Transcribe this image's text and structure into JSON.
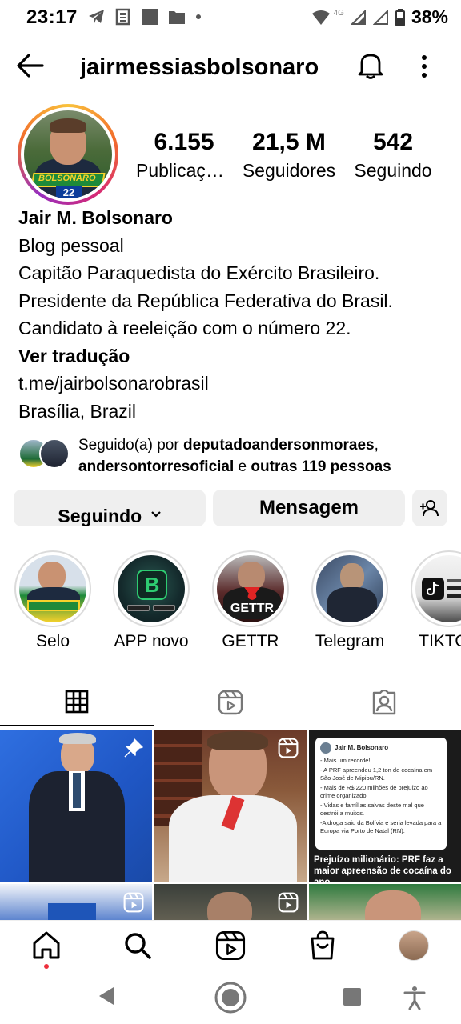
{
  "status_bar": {
    "time": "23:17",
    "network": "4G",
    "battery": "38%",
    "icons_left": [
      "telegram-icon",
      "news-icon",
      "square-icon",
      "folder-icon",
      "dot-icon"
    ],
    "icons_right": [
      "wifi-icon",
      "signal-icon",
      "signal-icon",
      "battery-icon"
    ]
  },
  "header": {
    "username": "jairmessiasbolsonaro",
    "icons": [
      "back-arrow-icon",
      "bell-icon",
      "more-vertical-icon"
    ]
  },
  "profile": {
    "stats": [
      {
        "value": "6.155",
        "label": "Publicações"
      },
      {
        "value": "21,5 M",
        "label": "Seguidores"
      },
      {
        "value": "542",
        "label": "Seguindo"
      }
    ],
    "name": "Jair M. Bolsonaro",
    "bio_lines": [
      "Blog pessoal",
      "Capitão Paraquedista do Exército Brasileiro.",
      "Presidente da República Federativa do Brasil.",
      "Candidato à reeleição com o número 22."
    ],
    "translate": "Ver tradução",
    "link": "t.me/jairbolsonarobrasil",
    "location": "Brasília, Brazil",
    "avatar_badge_text": "BOLSONARO",
    "avatar_number": "22"
  },
  "followed_by": {
    "prefix": "Seguido(a) por ",
    "user1": "deputadoandersonmoraes",
    "sep": ",",
    "user2": "andersontorresoficial",
    "middle": " e ",
    "others": "outras 119 pessoas"
  },
  "actions": {
    "following": "Seguindo",
    "message": "Mensagem"
  },
  "highlights": [
    {
      "label": "Selo"
    },
    {
      "label": "APP novo"
    },
    {
      "label": "GETTR"
    },
    {
      "label": "Telegram"
    },
    {
      "label": "TIKTOK"
    }
  ],
  "highlight_texts": {
    "gettr": "GETTR",
    "app": "B"
  },
  "tabs": [
    "grid-icon",
    "reels-icon",
    "tagged-icon"
  ],
  "posts": {
    "tweet_name": "Jair M. Bolsonaro",
    "tweet_lines": [
      "- Mais um recorde!",
      "- A PRF apreendeu 1,2 ton de cocaína em São José de Mipibu/RN.",
      "- Mais de R$ 220 milhões de prejuízo ao crime organizado.",
      "- Vidas e famílias salvas deste mal que destrói a muitos.",
      "-A droga saiu da Bolívia e seria levada para a Europa via Porto de Natal (RN)."
    ],
    "tweet_caption": "Prejuízo milionário: PRF faz a maior apreensão de cocaína do ano"
  },
  "bottom_nav": [
    "home-icon",
    "search-icon",
    "reels-icon",
    "shop-icon",
    "profile-avatar"
  ],
  "colors": {
    "accent_red": "#ed2f3c",
    "button_bg": "#efefef",
    "green": "#1e8a3a",
    "yellow": "#f6d22b"
  }
}
